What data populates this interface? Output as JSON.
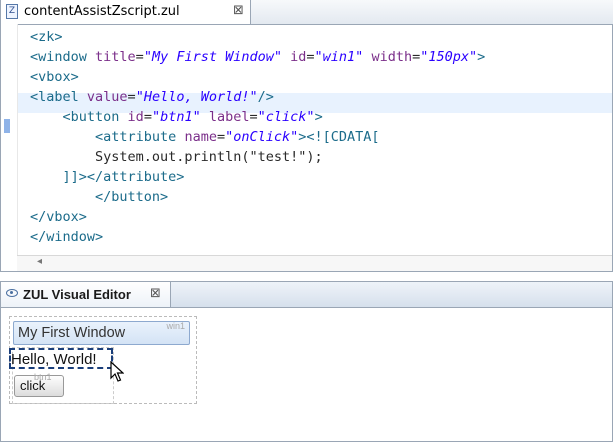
{
  "editor": {
    "tab_title": "contentAssistZscript.zul",
    "tab_icon": "zul-file-icon",
    "close_glyph": "⊠",
    "lines": [
      [
        {
          "t": "tag",
          "v": "<zk>"
        }
      ],
      [
        {
          "t": "tag",
          "v": "<window "
        },
        {
          "t": "attr",
          "v": "title"
        },
        {
          "t": "plain",
          "v": "="
        },
        {
          "t": "str",
          "v": "\"My First Window\""
        },
        {
          "t": "plain",
          "v": " "
        },
        {
          "t": "attr",
          "v": "id"
        },
        {
          "t": "plain",
          "v": "="
        },
        {
          "t": "str",
          "v": "\"win1\""
        },
        {
          "t": "plain",
          "v": " "
        },
        {
          "t": "attr",
          "v": "width"
        },
        {
          "t": "plain",
          "v": "="
        },
        {
          "t": "str",
          "v": "\"150px\""
        },
        {
          "t": "tag",
          "v": ">"
        }
      ],
      [
        {
          "t": "tag",
          "v": "<vbox>"
        }
      ],
      [
        {
          "t": "tag",
          "v": "<label "
        },
        {
          "t": "attr",
          "v": "value"
        },
        {
          "t": "plain",
          "v": "="
        },
        {
          "t": "str",
          "v": "\"Hello, World!\""
        },
        {
          "t": "tag",
          "v": "/>"
        }
      ],
      [
        {
          "t": "plain",
          "v": "    "
        },
        {
          "t": "tag",
          "v": "<button "
        },
        {
          "t": "attr",
          "v": "id"
        },
        {
          "t": "plain",
          "v": "="
        },
        {
          "t": "str",
          "v": "\"btn1\""
        },
        {
          "t": "plain",
          "v": " "
        },
        {
          "t": "attr",
          "v": "label"
        },
        {
          "t": "plain",
          "v": "="
        },
        {
          "t": "str",
          "v": "\"click\""
        },
        {
          "t": "tag",
          "v": ">"
        }
      ],
      [
        {
          "t": "plain",
          "v": "        "
        },
        {
          "t": "tag",
          "v": "<attribute "
        },
        {
          "t": "attr",
          "v": "name"
        },
        {
          "t": "plain",
          "v": "="
        },
        {
          "t": "str",
          "v": "\"onClick\""
        },
        {
          "t": "tag",
          "v": ">"
        },
        {
          "t": "cdata",
          "v": "<![CDATA["
        }
      ],
      [
        {
          "t": "plain",
          "v": "        System.out.println(\"test!\");"
        }
      ],
      [
        {
          "t": "plain",
          "v": "    "
        },
        {
          "t": "cdata",
          "v": "]]>"
        },
        {
          "t": "tag",
          "v": "</attribute>"
        }
      ],
      [
        {
          "t": "plain",
          "v": "        "
        },
        {
          "t": "tag",
          "v": "</button>"
        }
      ],
      [
        {
          "t": "tag",
          "v": "</vbox>"
        }
      ],
      [
        {
          "t": "tag",
          "v": "</window>"
        }
      ]
    ],
    "current_line_index": 3,
    "scroll_left_glyph": "◂"
  },
  "visual_editor": {
    "tab_title": "ZUL Visual Editor",
    "close_glyph": "⊠",
    "window_title": "My First Window",
    "window_id": "win1",
    "label_text": "Hello, World!",
    "button_label": "click",
    "button_id": "btn1"
  }
}
